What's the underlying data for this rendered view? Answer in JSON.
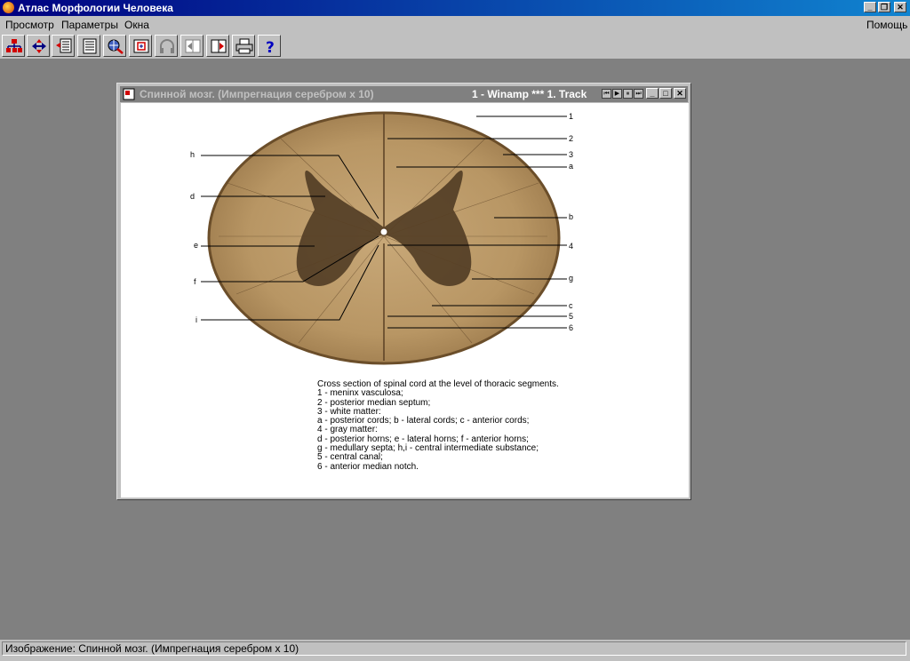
{
  "app": {
    "title": "Атлас Морфологии Человека",
    "controls": {
      "minimize": "_",
      "restore": "❐",
      "close": "✕"
    }
  },
  "menu": {
    "items": [
      "Просмотр",
      "Параметры",
      "Окна"
    ],
    "help": "Помощь"
  },
  "toolbar": {
    "buttons": [
      "tree-icon",
      "navigate-arrows-icon",
      "document-arrow-icon",
      "document-text-icon",
      "zoom-globe-icon",
      "fit-screen-icon",
      "headphones-icon",
      "prev-page-icon",
      "next-page-icon",
      "printer-icon",
      "help-icon"
    ]
  },
  "window": {
    "title": "Спинной мозг. (Импрегнация серебром х 10)",
    "winamp": "1 - Winamp *** 1. Track",
    "winamp_controls": [
      "⏮",
      "▶",
      "⏸",
      "⏭"
    ],
    "controls": {
      "minimize": "_",
      "maximize": "□",
      "close": "✕"
    }
  },
  "image": {
    "description_type": "spinal-cord-cross-section",
    "left_labels": [
      "h",
      "d",
      "e",
      "f",
      "i"
    ],
    "right_labels": [
      "1",
      "2",
      "3",
      "a",
      "b",
      "4",
      "g",
      "c",
      "5",
      "6"
    ]
  },
  "caption": {
    "lines": [
      "Cross section of spinal cord at the level of thoracic segments.",
      "1 - meninx vasculosa;",
      "2 - posterior median septum;",
      "3 - white matter:",
      "a - posterior cords; b - lateral cords; c - anterior cords;",
      "4 - gray matter:",
      "d - posterior horns; e - lateral horns; f - anterior horns;",
      "g - medullary septa; h,i - central intermediate substance;",
      "5 - central canal;",
      "6 - anterior median notch."
    ]
  },
  "status": {
    "text": "Изображение: Спинной мозг. (Импрегнация серебром х 10)"
  }
}
